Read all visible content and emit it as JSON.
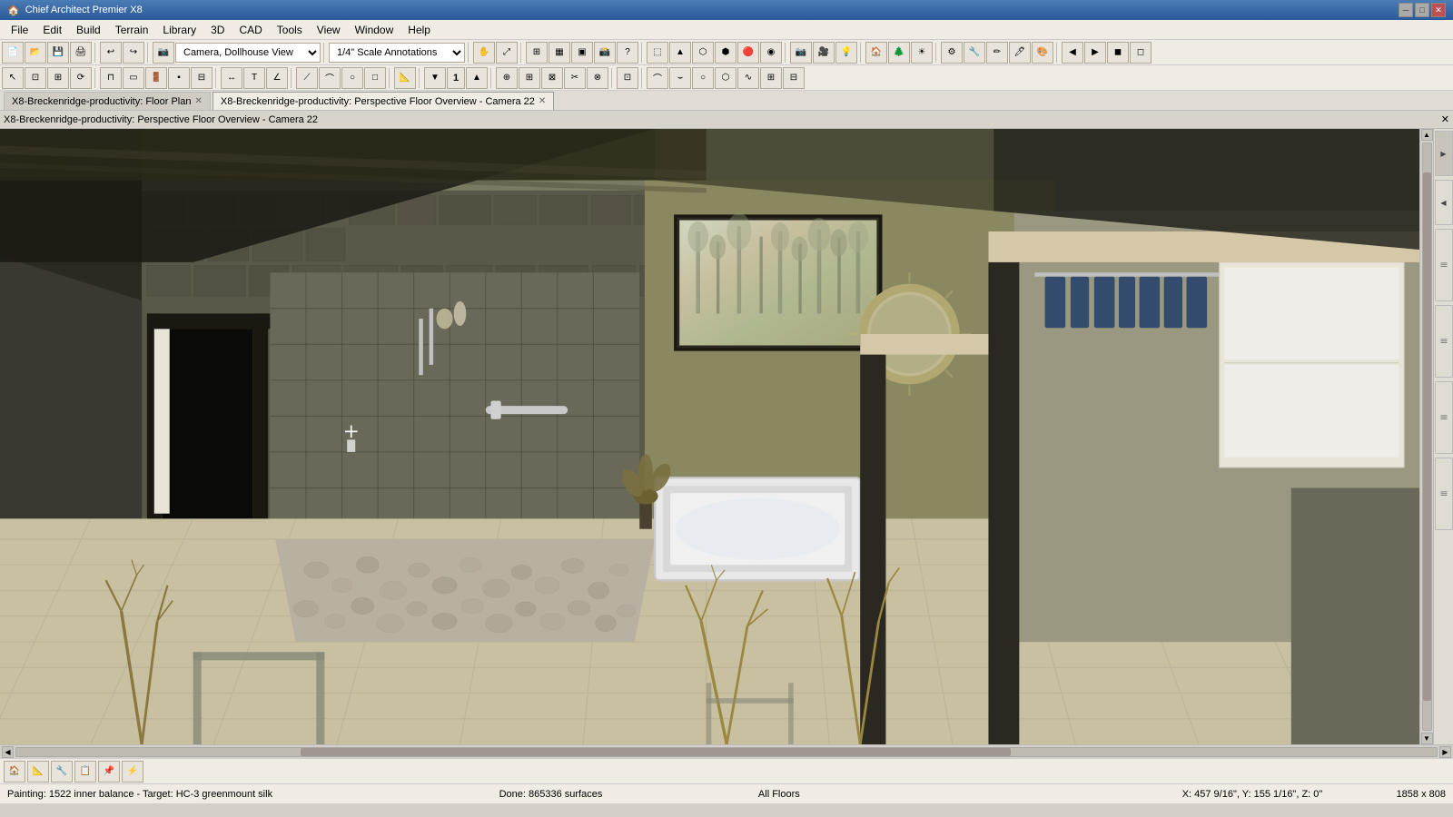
{
  "app": {
    "title": "Chief Architect Premier X8",
    "icon": "🏠"
  },
  "titlebar": {
    "title": "Chief Architect Premier X8",
    "minimize_label": "─",
    "maximize_label": "□",
    "close_label": "✕"
  },
  "menu": {
    "items": [
      "File",
      "Edit",
      "Build",
      "Terrain",
      "Library",
      "3D",
      "CAD",
      "Tools",
      "View",
      "Window",
      "Help"
    ]
  },
  "toolbar1": {
    "camera_dropdown": "Camera, Dollhouse View",
    "scale_dropdown": "1/4\" Scale Annotations"
  },
  "tabs": [
    {
      "label": "X8-Breckenridge-productivity: Floor Plan",
      "active": false,
      "closeable": true
    },
    {
      "label": "X8-Breckenridge-productivity: Perspective Floor Overview - Camera 22",
      "active": true,
      "closeable": true
    }
  ],
  "view_title": "X8-Breckenridge-productivity: Perspective Floor Overview - Camera 22",
  "statusbar": {
    "painting": "Painting: 1522 inner balance - Target: HC-3 greenmount silk",
    "done": "Done:  865336 surfaces",
    "floors": "All Floors",
    "coords": "X: 457 9/16\", Y: 155 1/16\", Z: 0\"",
    "dims": "1858 x 808"
  },
  "right_sidebar": {
    "tabs": [
      "▶",
      "▶",
      "▶",
      "▶",
      "▶",
      "▶"
    ]
  },
  "bottom_toolbar": {
    "icons": [
      "🏠",
      "📐",
      "🔧",
      "📋",
      "📌",
      "⚡"
    ]
  },
  "scene": {
    "description": "3D dollhouse view of bathroom interior with tile floor, shower area, bathtub, and adjacent rooms"
  }
}
